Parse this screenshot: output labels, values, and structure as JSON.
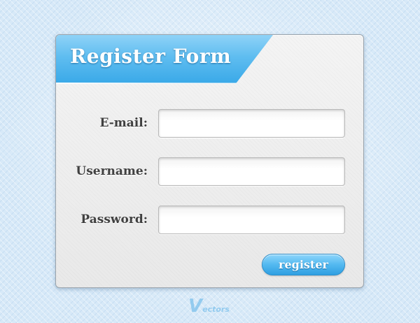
{
  "form": {
    "title": "Register Form",
    "fields": [
      {
        "label": "E-mail:",
        "value": "",
        "placeholder": ""
      },
      {
        "label": "Username:",
        "value": "",
        "placeholder": ""
      },
      {
        "label": "Password:",
        "value": "",
        "placeholder": ""
      }
    ],
    "submit_label": "register"
  },
  "watermark": {
    "letter": "V",
    "text": "ectors"
  },
  "colors": {
    "accent": "#4ab4ee",
    "panel": "#efefef",
    "label_text": "#404040",
    "background": "#d7e9f8"
  }
}
